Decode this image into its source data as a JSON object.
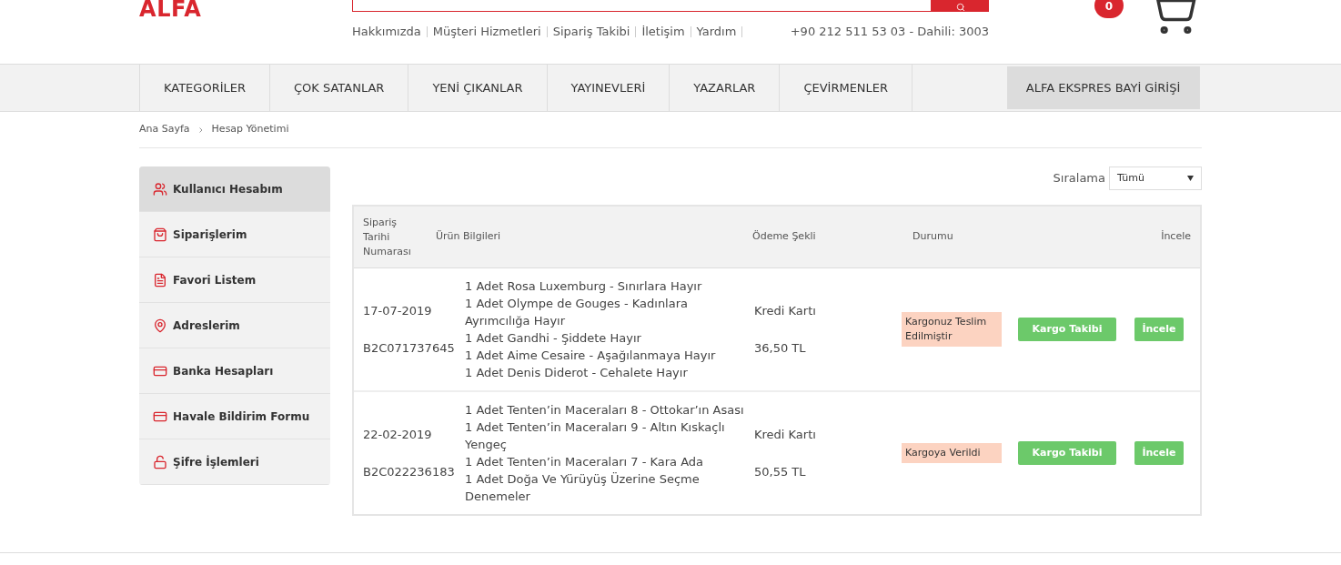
{
  "header": {
    "logo": "ALFA",
    "top_links": [
      "Hakkımızda",
      "Müşteri Hizmetleri",
      "Sipariş Takibi",
      "İletişim",
      "Yardım"
    ],
    "phone": "+90 212 511 53 03 - Dahili: 3003",
    "cart_count": "0"
  },
  "nav": [
    {
      "label": "KATEGORİLER",
      "kind": "menu"
    },
    {
      "label": "ÇOK SATANLAR",
      "kind": "menu"
    },
    {
      "label": "YENİ ÇIKANLAR",
      "kind": "menu"
    },
    {
      "label": "YAYINEVLERİ",
      "kind": "menu"
    },
    {
      "label": "YAZARLAR",
      "kind": "menu"
    },
    {
      "label": "ÇEVİRMENLER",
      "kind": "menu"
    },
    {
      "label": "ALFA EKSPRES BAYİ GİRİŞİ",
      "kind": "dealer"
    }
  ],
  "breadcrumb": [
    "Ana Sayfa",
    "Hesap Yönetimi"
  ],
  "sidebar": {
    "items": [
      {
        "label": "Kullanıcı Hesabım",
        "selected": true
      },
      {
        "label": "Siparişlerim",
        "selected": false
      },
      {
        "label": "Favori Listem",
        "selected": false
      },
      {
        "label": "Adreslerim",
        "selected": false
      },
      {
        "label": "Banka Hesapları",
        "selected": false
      },
      {
        "label": "Havale Bildirim Formu",
        "selected": false
      },
      {
        "label": "Şifre İşlemleri",
        "selected": false
      }
    ]
  },
  "sort": {
    "label": "Sıralama",
    "value": "Tümü"
  },
  "table": {
    "columns": [
      [
        "Sipariş",
        "Tarihi",
        "Numarası"
      ],
      [
        "Ürün Bilgileri"
      ],
      [
        "Ödeme Şekli"
      ],
      [
        "Durumu"
      ],
      [
        "İncele"
      ]
    ],
    "rows": [
      {
        "date": "17-07-2019",
        "number": "B2C071737645",
        "items": [
          "1 Adet Rosa Luxemburg - Sınırlara Hayır",
          "1 Adet Olympe de Gouges - Kadınlara Ayrımcılığa Hayır",
          "1 Adet Gandhi - Şiddete Hayır",
          "1 Adet Aime Cesaire - Aşağılanmaya Hayır",
          "1 Adet Denis Diderot - Cehalete Hayır"
        ],
        "payment": "Kredi Kartı",
        "total": "36,50 TL",
        "status": "Kargonuz Teslim Edilmiştir",
        "track_button": "Kargo Takibi",
        "view_button": "İncele"
      },
      {
        "date": "22-02-2019",
        "number": "B2C022236183",
        "items": [
          "1 Adet Tenten’in Maceraları 8 - Ottokar’ın Asası",
          "1 Adet Tenten’in Maceraları 9 - Altın Kıskaçlı Yengeç",
          "1 Adet Tenten’in Maceraları 7 - Kara Ada",
          "1 Adet Doğa Ve Yürüyüş Üzerine Seçme Denemeler"
        ],
        "payment": "Kredi Kartı",
        "total": "50,55 TL",
        "status": "Kargoya Verildi",
        "track_button": "Kargo Takibi",
        "view_button": "İncele"
      }
    ]
  }
}
